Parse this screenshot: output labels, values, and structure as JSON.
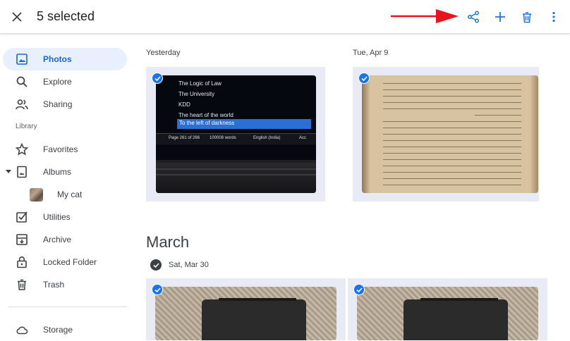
{
  "topbar": {
    "selected_label": "5 selected",
    "icons": [
      "close-icon",
      "share-icon",
      "add-icon",
      "trash-icon",
      "more-vert-icon"
    ],
    "annotation_color": "#e8131b"
  },
  "sidebar": {
    "items": [
      {
        "label": "Photos",
        "icon": "photos-icon",
        "active": true
      },
      {
        "label": "Explore",
        "icon": "search-icon"
      },
      {
        "label": "Sharing",
        "icon": "people-icon"
      },
      {
        "label": "Favorites",
        "icon": "star-icon"
      },
      {
        "label": "Albums",
        "icon": "album-icon"
      },
      {
        "label": "My cat",
        "icon": "thumbnail"
      },
      {
        "label": "Utilities",
        "icon": "utilities-icon"
      },
      {
        "label": "Archive",
        "icon": "archive-icon"
      },
      {
        "label": "Locked Folder",
        "icon": "lock-icon"
      },
      {
        "label": "Trash",
        "icon": "trash-icon"
      },
      {
        "label": "Storage",
        "icon": "cloud-icon"
      }
    ],
    "library_label": "Library"
  },
  "main": {
    "groups": [
      {
        "date": "Yesterday"
      },
      {
        "date": "Tue, Apr 9"
      }
    ],
    "month": "March",
    "sub_date": "Sat, Mar 30",
    "screen_lines": [
      "The Logic of Law",
      "The University",
      "KDD",
      "The heart of the world",
      "To the left of darkness"
    ],
    "screen_status": [
      "Page 261 of 266",
      "100008 words",
      "English (India)",
      "Acc"
    ],
    "accent_color": "#1a73e8"
  }
}
